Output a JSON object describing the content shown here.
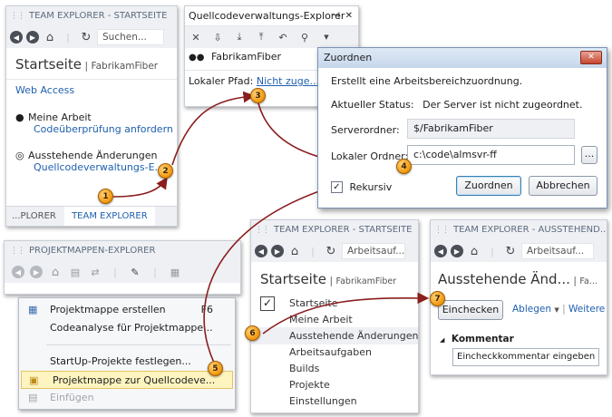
{
  "te1": {
    "title": "TEAM EXPLORER - STARTSEITE",
    "search_placeholder": "Suchen...",
    "heading": "Startseite",
    "project": "FabrikamFiber",
    "web_access": "Web Access",
    "my_work": "Meine Arbeit",
    "code_review": "Codeüberprüfung anfordern",
    "pending": "Ausstehende Änderungen",
    "source_control_link": "Quellcodeverwaltungs-E...",
    "tab_explorer": "...PLORER",
    "tab_team": "TEAM EXPLORER"
  },
  "sce": {
    "title": "Quellcodeverwaltungs-Explorer",
    "pin_glyph": "⊣",
    "close_glyph": "✕",
    "workspace": "FabrikamFiber",
    "local_path_label": "Lokaler Pfad:",
    "local_path_value": "Nicht zuge..."
  },
  "dialog": {
    "title": "Zuordnen",
    "close_glyph": "✕",
    "intro": "Erstellt eine Arbeitsbereichzuordnung.",
    "status_label": "Aktueller Status:",
    "status_value": "Der Server ist nicht zugeordnet.",
    "server_label": "Serverordner:",
    "server_value": "$/FabrikamFiber",
    "local_label": "Lokaler Ordner:",
    "local_value": "c:\\code\\almsvr-ff",
    "browse_label": "...",
    "recursive_label": "Rekursiv",
    "recursive_check": "✓",
    "map_button": "Zuordnen",
    "cancel_button": "Abbrechen"
  },
  "pme": {
    "title": "PROJEKTMAPPEN-EXPLORER",
    "menu": {
      "create_solution": "Projektmappe erstellen",
      "create_shortcut": "F6",
      "code_analysis": "Codeanalyse für Projektmappe...",
      "startup": "StartUp-Projekte festlegen...",
      "add_to_sc": "Projektmappe zur Quellcodeve...",
      "paste": "Einfügen"
    }
  },
  "te2": {
    "title": "TEAM EXPLORER - STARTSEITE",
    "search_placeholder": "Arbeitsauf...",
    "heading": "Startseite",
    "project": "FabrikamFiber",
    "check_glyph": "✓",
    "nav": [
      "Startseite",
      "Meine Arbeit",
      "Ausstehende Änderungen",
      "Arbeitsaufgaben",
      "Builds",
      "Projekte",
      "Einstellungen"
    ]
  },
  "te3": {
    "title": "TEAM EXPLORER - AUSSTEHEND...",
    "search_placeholder": "Arbeitsauf...",
    "heading": "Ausstehende Änd...",
    "project": "Fa...",
    "checkin_button": "Einchecken",
    "shelve_link": "Ablegen",
    "more_link": "Weitere",
    "comment_header": "Kommentar",
    "comment_placeholder": "Eincheckkommentar eingeben"
  },
  "steps": [
    "1",
    "2",
    "3",
    "4",
    "5",
    "6",
    "7"
  ],
  "colors": {
    "accent_link": "#1e5fae",
    "tab_active": "#1e5fae",
    "step_orange": "#f0960a",
    "arrow": "#8b1e1e"
  }
}
